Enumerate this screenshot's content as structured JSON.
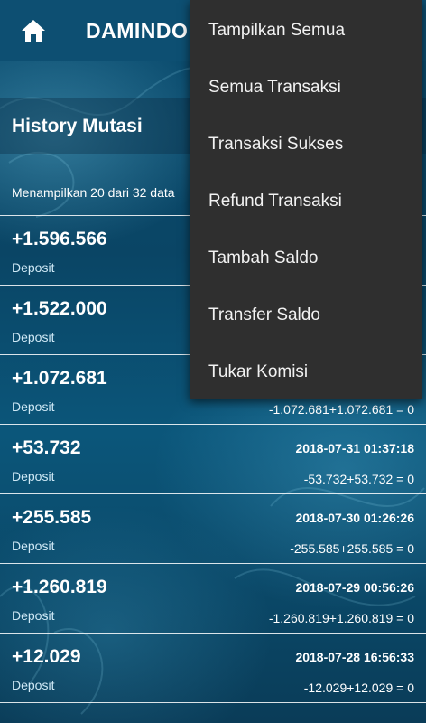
{
  "appbar": {
    "title": "DAMINDO"
  },
  "history": {
    "title": "History Mutasi",
    "showing_text": "Menampilkan 20 dari 32 data"
  },
  "transactions": [
    {
      "amount": "+1.596.566",
      "type": "Deposit",
      "date": "",
      "calc": ""
    },
    {
      "amount": "+1.522.000",
      "type": "Deposit",
      "date": "",
      "calc": ""
    },
    {
      "amount": "+1.072.681",
      "type": "Deposit",
      "date": "",
      "calc": "-1.072.681+1.072.681 = 0"
    },
    {
      "amount": "+53.732",
      "type": "Deposit",
      "date": "2018-07-31 01:37:18",
      "calc": "-53.732+53.732 = 0"
    },
    {
      "amount": "+255.585",
      "type": "Deposit",
      "date": "2018-07-30 01:26:26",
      "calc": "-255.585+255.585 = 0"
    },
    {
      "amount": "+1.260.819",
      "type": "Deposit",
      "date": "2018-07-29 00:56:26",
      "calc": "-1.260.819+1.260.819 = 0"
    },
    {
      "amount": "+12.029",
      "type": "Deposit",
      "date": "2018-07-28 16:56:33",
      "calc": "-12.029+12.029 = 0"
    }
  ],
  "menu": {
    "items": [
      "Tampilkan Semua",
      "Semua Transaksi",
      "Transaksi Sukses",
      "Refund Transaksi",
      "Tambah Saldo",
      "Transfer Saldo",
      "Tukar Komisi"
    ]
  },
  "icons": {
    "home": "home-icon"
  },
  "colors": {
    "appbar": "#0d4f72",
    "menu_bg": "#2f2f2f",
    "background": "#0b3f5e"
  }
}
